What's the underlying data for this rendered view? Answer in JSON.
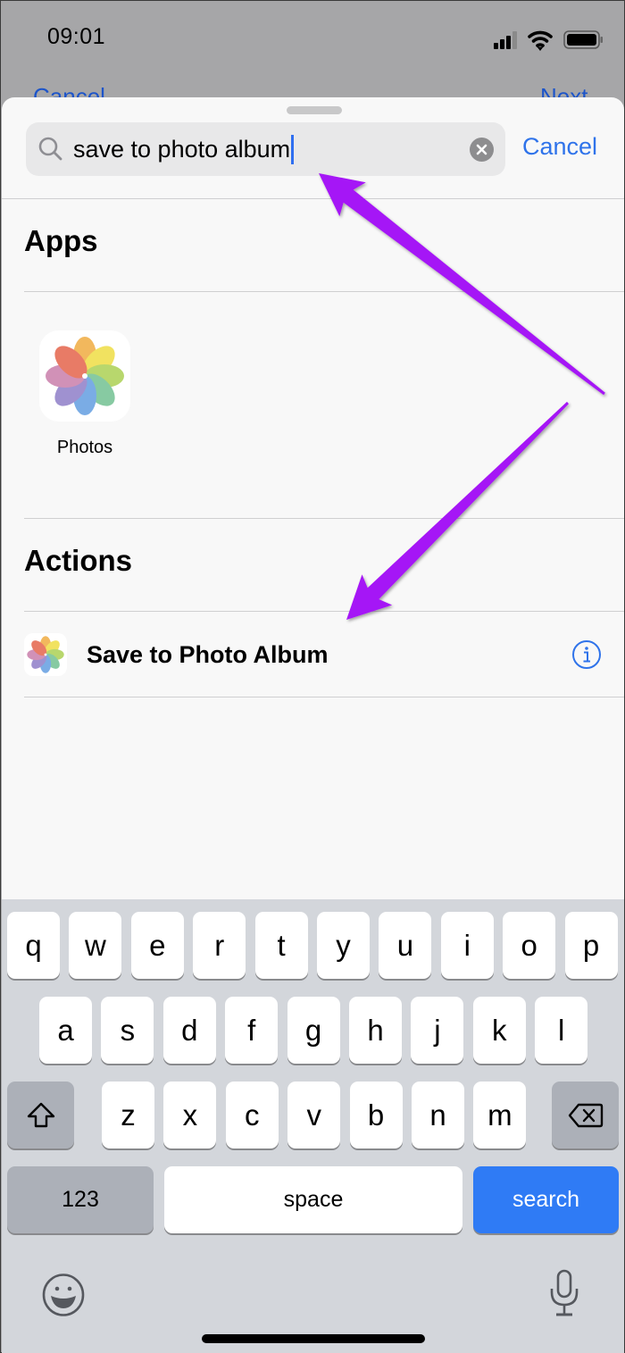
{
  "status_bar": {
    "time": "09:01",
    "icons": [
      "cellular-signal-icon",
      "wifi-icon",
      "battery-icon"
    ]
  },
  "background_nav": {
    "left_label": "Cancel",
    "right_label": "Next"
  },
  "search": {
    "query": "save to photo album",
    "cancel_label": "Cancel",
    "search_icon": "magnifying-glass-icon",
    "clear_icon": "clear-x-icon"
  },
  "sections": {
    "apps": {
      "title": "Apps",
      "items": [
        {
          "label": "Photos",
          "icon": "photos-app-icon"
        }
      ]
    },
    "actions": {
      "title": "Actions",
      "items": [
        {
          "label": "Save to Photo Album",
          "icon": "photos-app-icon",
          "accessory": "info-icon"
        }
      ]
    }
  },
  "annotations": {
    "arrow_color": "#a513f6",
    "count": 2
  },
  "keyboard": {
    "row1": [
      "q",
      "w",
      "e",
      "r",
      "t",
      "y",
      "u",
      "i",
      "o",
      "p"
    ],
    "row2": [
      "a",
      "s",
      "d",
      "f",
      "g",
      "h",
      "j",
      "k",
      "l"
    ],
    "row3": [
      "z",
      "x",
      "c",
      "v",
      "b",
      "n",
      "m"
    ],
    "numbers_label": "123",
    "space_label": "space",
    "return_label": "search",
    "shift_icon": "shift-icon",
    "delete_icon": "backspace-icon",
    "emoji_icon": "emoji-icon",
    "mic_icon": "microphone-icon"
  },
  "colors": {
    "accent": "#2f73ea",
    "return_key": "#2f7bf5",
    "keyboard_bg": "#d3d6db"
  }
}
